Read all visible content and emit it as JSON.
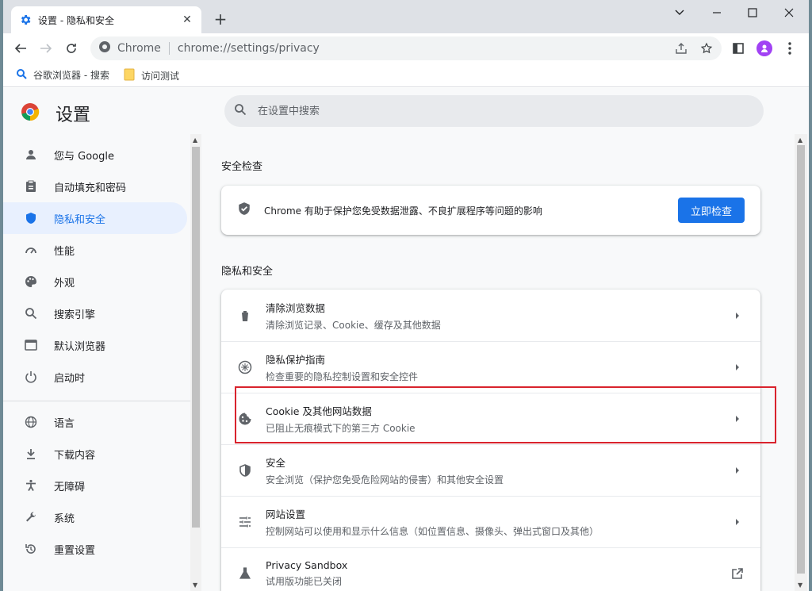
{
  "window": {
    "tab_title": "设置 - 隐私和安全",
    "new_tab": "+"
  },
  "toolbar": {
    "site_label": "Chrome",
    "url": "chrome://settings/privacy"
  },
  "bookmarks": [
    {
      "label": "谷歌浏览器 - 搜索",
      "icon": "google-search-icon"
    },
    {
      "label": "访问测试",
      "icon": "folder-icon"
    }
  ],
  "settings": {
    "title": "设置",
    "search_placeholder": "在设置中搜索"
  },
  "sidebar": {
    "items": [
      {
        "label": "您与 Google",
        "icon": "person-icon"
      },
      {
        "label": "自动填充和密码",
        "icon": "clipboard-icon"
      },
      {
        "label": "隐私和安全",
        "icon": "shield-icon",
        "active": true
      },
      {
        "label": "性能",
        "icon": "speedometer-icon"
      },
      {
        "label": "外观",
        "icon": "palette-icon"
      },
      {
        "label": "搜索引擎",
        "icon": "search-icon"
      },
      {
        "label": "默认浏览器",
        "icon": "browser-icon"
      },
      {
        "label": "启动时",
        "icon": "power-icon"
      },
      {
        "label": "语言",
        "icon": "globe-icon"
      },
      {
        "label": "下载内容",
        "icon": "download-icon"
      },
      {
        "label": "无障碍",
        "icon": "accessibility-icon"
      },
      {
        "label": "系统",
        "icon": "wrench-icon"
      },
      {
        "label": "重置设置",
        "icon": "restore-icon"
      }
    ]
  },
  "safety_check": {
    "section_title": "安全检查",
    "description": "Chrome 有助于保护您免受数据泄露、不良扩展程序等问题的影响",
    "button_label": "立即检查"
  },
  "privacy": {
    "section_title": "隐私和安全",
    "rows": [
      {
        "title": "清除浏览数据",
        "subtitle": "清除浏览记录、Cookie、缓存及其他数据",
        "icon": "trash-icon",
        "trailing": "chevron-right-icon"
      },
      {
        "title": "隐私保护指南",
        "subtitle": "检查重要的隐私控制设置和安全控件",
        "icon": "privacy-guide-icon",
        "trailing": "chevron-right-icon"
      },
      {
        "title": "Cookie 及其他网站数据",
        "subtitle": "已阻止无痕模式下的第三方 Cookie",
        "icon": "cookie-icon",
        "trailing": "chevron-right-icon"
      },
      {
        "title": "安全",
        "subtitle": "安全浏览（保护您免受危险网站的侵害）和其他安全设置",
        "icon": "security-shield-icon",
        "trailing": "chevron-right-icon"
      },
      {
        "title": "网站设置",
        "subtitle": "控制网站可以使用和显示什么信息（如位置信息、摄像头、弹出式窗口及其他）",
        "icon": "tune-icon",
        "trailing": "chevron-right-icon"
      },
      {
        "title": "Privacy Sandbox",
        "subtitle": "试用版功能已关闭",
        "icon": "flask-icon",
        "trailing": "open-external-icon"
      }
    ]
  },
  "colors": {
    "accent": "#1a73e8",
    "active_bg": "#e8f0fe",
    "highlight_box": "#d9232d"
  }
}
